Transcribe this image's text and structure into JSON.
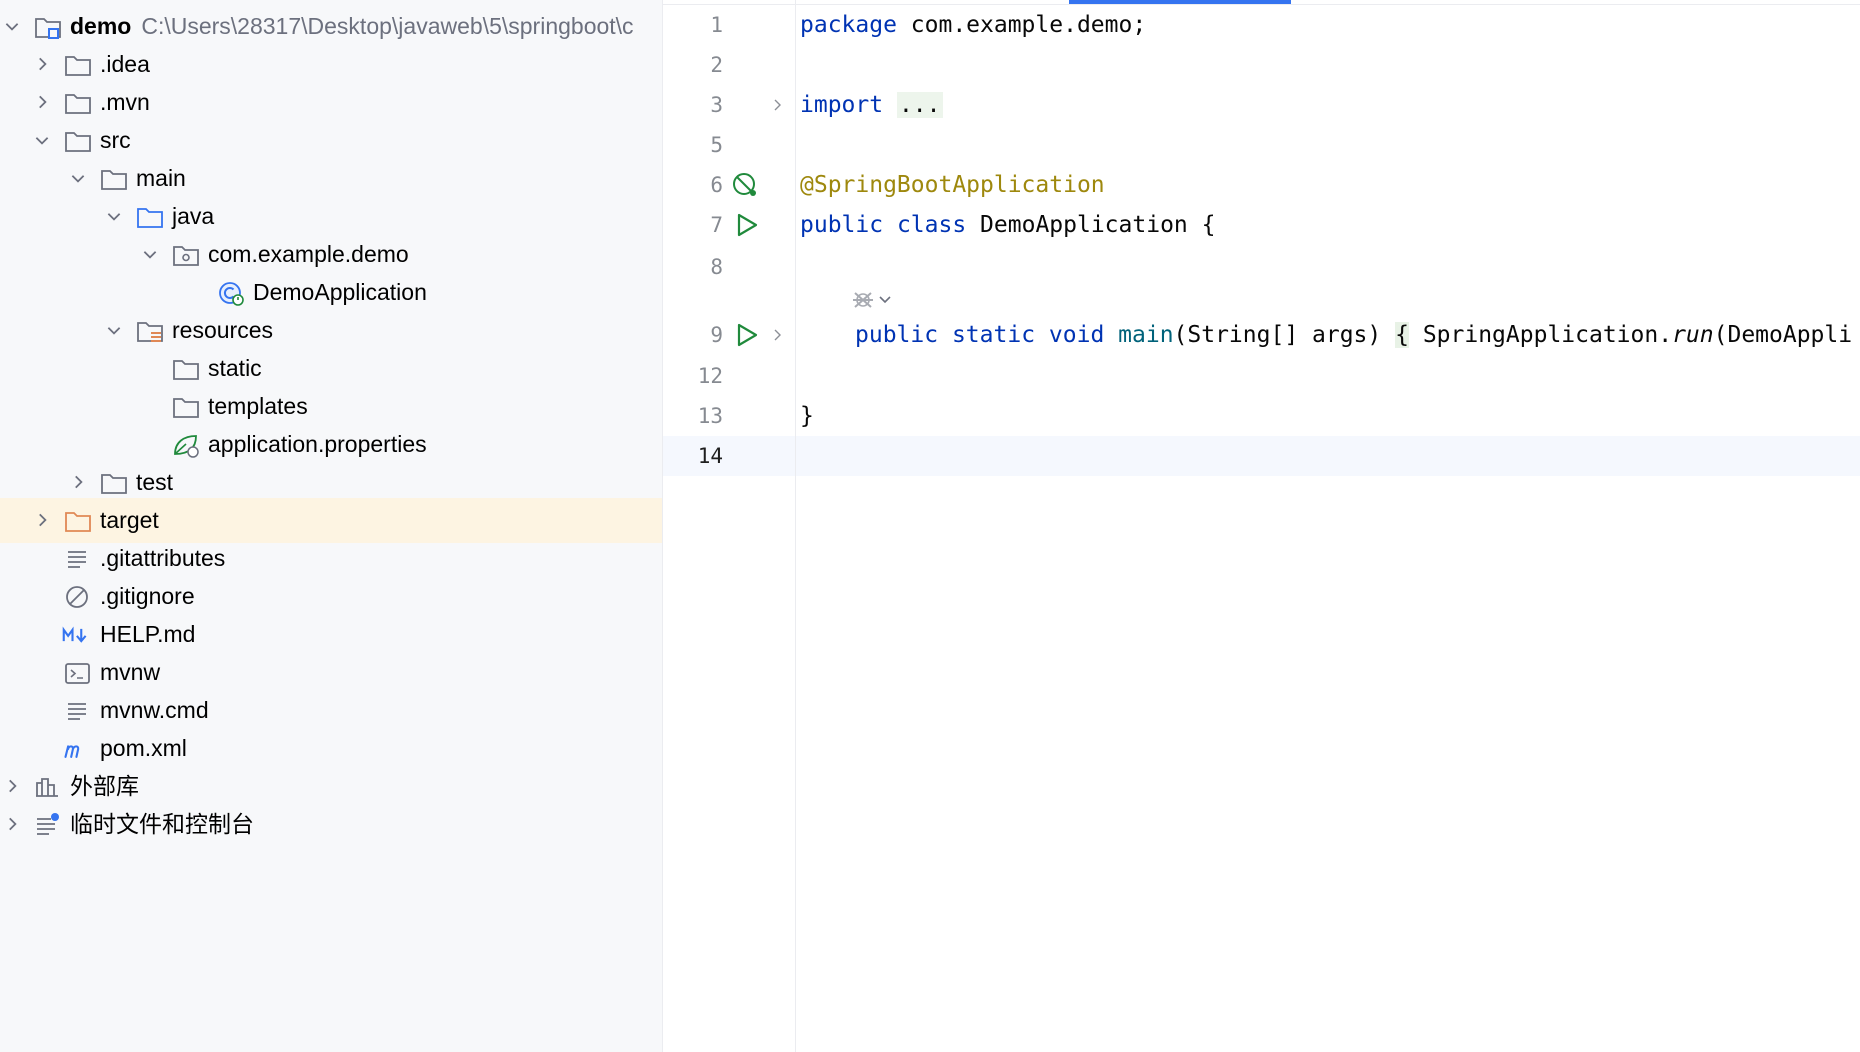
{
  "project_tree": {
    "root": {
      "label": "demo",
      "path": "C:\\Users\\28317\\Desktop\\javaweb\\5\\springboot\\c"
    },
    "items": [
      {
        "label": ".idea"
      },
      {
        "label": ".mvn"
      },
      {
        "label": "src"
      },
      {
        "label": "main"
      },
      {
        "label": "java"
      },
      {
        "label": "com.example.demo"
      },
      {
        "label": "DemoApplication"
      },
      {
        "label": "resources"
      },
      {
        "label": "static"
      },
      {
        "label": "templates"
      },
      {
        "label": "application.properties"
      },
      {
        "label": "test"
      },
      {
        "label": "target"
      },
      {
        "label": ".gitattributes"
      },
      {
        "label": ".gitignore"
      },
      {
        "label": "HELP.md"
      },
      {
        "label": "mvnw"
      },
      {
        "label": "mvnw.cmd"
      },
      {
        "label": "pom.xml"
      },
      {
        "label": "外部库"
      },
      {
        "label": "临时文件和控制台"
      }
    ]
  },
  "editor": {
    "line_numbers": [
      "1",
      "2",
      "3",
      "5",
      "6",
      "7",
      "8",
      "9",
      "12",
      "13",
      "14"
    ],
    "code": {
      "l1_kw": "package",
      "l1_rest": " com.example.demo;",
      "l3_kw": "import",
      "l3_fold": "...",
      "l6_ann": "@SpringBootApplication",
      "l7_kw1": "public",
      "l7_kw2": "class",
      "l7_rest": " DemoApplication {",
      "l9_kw1": "public",
      "l9_kw2": "static",
      "l9_kw3": "void",
      "l9_fn": "main",
      "l9_args": "(String[] args) ",
      "l9_brace": "{",
      "l9_call": " SpringApplication.",
      "l9_run": "run",
      "l9_tail": "(DemoAppli",
      "l13": "}"
    }
  },
  "colors": {
    "keyword": "#0033b3",
    "annotation": "#9e880d",
    "method": "#00627a",
    "selection_bg": "#fdf4e2",
    "run_icon": "#208a3c",
    "folder_icon": "#6c707e",
    "source_folder_icon": "#3574f0",
    "target_folder_icon": "#e08855"
  },
  "icons": {
    "chevron_right": "chevron-right-icon",
    "chevron_down": "chevron-down-icon",
    "folder": "folder-icon",
    "run": "run-icon"
  }
}
